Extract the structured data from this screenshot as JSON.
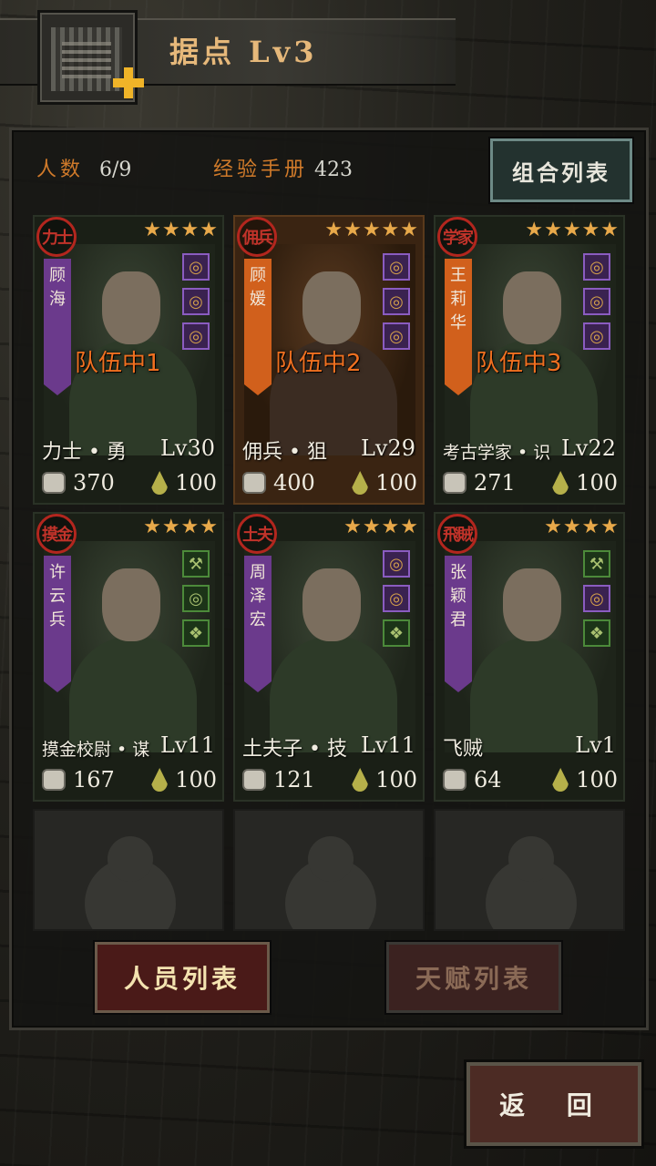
{
  "header": {
    "title": "据点  Lv3"
  },
  "stats": {
    "population_label": "人数",
    "population_value": "6/9",
    "exp_label": "经验手册",
    "exp_value": "423"
  },
  "combo_button": "组合列表",
  "characters": [
    {
      "seal": "力士",
      "name": "顾海",
      "class_text": "力士 • 勇",
      "level": "Lv30",
      "power": "370",
      "water": "100",
      "team": "队伍中1",
      "stars": "★★★★"
    },
    {
      "seal": "佣兵",
      "name": "顾媛",
      "class_text": "佣兵 • 狙",
      "level": "Lv29",
      "power": "400",
      "water": "100",
      "team": "队伍中2",
      "stars": "★★★★★"
    },
    {
      "seal": "学家",
      "name": "王莉华",
      "class_text": "考古学家 • 识",
      "level": "Lv22",
      "power": "271",
      "water": "100",
      "team": "队伍中3",
      "stars": "★★★★★"
    },
    {
      "seal": "摸金",
      "name": "许云兵",
      "class_text": "摸金校尉 • 谋",
      "level": "Lv11",
      "power": "167",
      "water": "100",
      "team": "",
      "stars": "★★★★"
    },
    {
      "seal": "土夫",
      "name": "周泽宏",
      "class_text": "土夫子 • 技",
      "level": "Lv11",
      "power": "121",
      "water": "100",
      "team": "",
      "stars": "★★★★"
    },
    {
      "seal": "飛賊",
      "name": "张颖君",
      "class_text": "飞贼",
      "level": "Lv1",
      "power": "64",
      "water": "100",
      "team": "",
      "stars": "★★★★"
    }
  ],
  "tabs": {
    "personnel": "人员列表",
    "talents": "天赋列表"
  },
  "back_button": "返 回"
}
